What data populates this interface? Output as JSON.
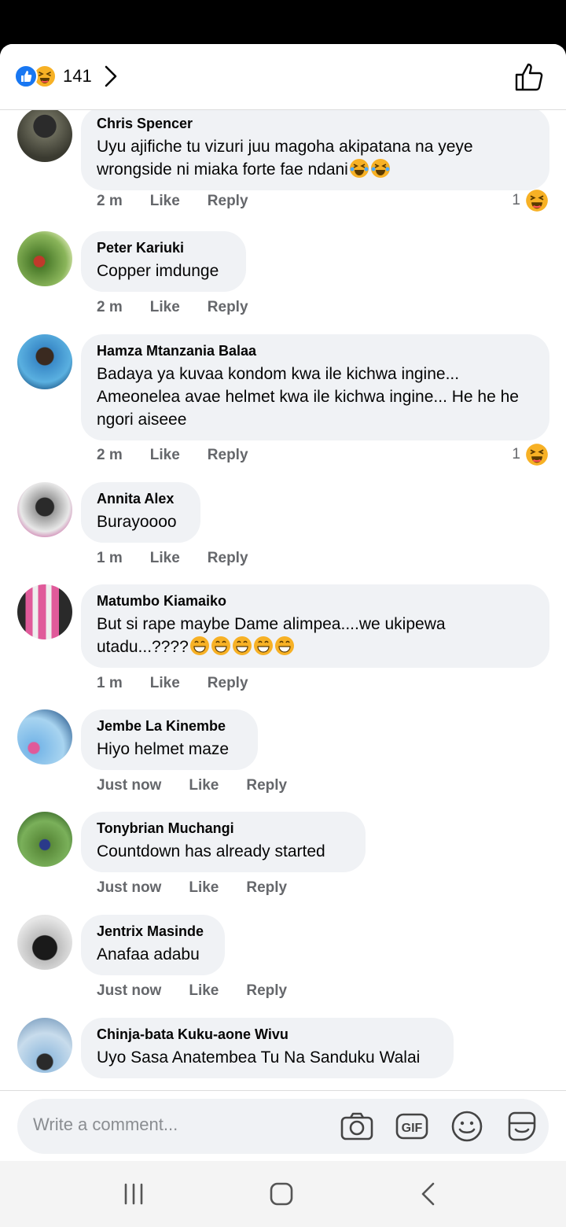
{
  "header": {
    "reaction_count": "141",
    "reaction_icons": [
      "like-icon",
      "haha-icon"
    ]
  },
  "comments": [
    {
      "author": "Chris Spencer",
      "text": "Uyu ajifiche tu vizuri juu magoha akipatana na yeye wrongside ni miaka forte fae ndani",
      "trailing_emoji": [
        "laughing-tears",
        "laughing-tears"
      ],
      "time": "2 m",
      "like_label": "Like",
      "reply_label": "Reply",
      "reaction_count": "1",
      "reaction_icon": "haha-icon"
    },
    {
      "author": "Peter Kariuki",
      "text": "Copper imdunge",
      "time": "2 m",
      "like_label": "Like",
      "reply_label": "Reply"
    },
    {
      "author": "Hamza Mtanzania Balaa",
      "text": "Badaya ya kuvaa kondom kwa ile kichwa ingine... Ameonelea avae helmet kwa ile kichwa ingine... He he he ngori aiseee",
      "time": "2 m",
      "like_label": "Like",
      "reply_label": "Reply",
      "reaction_count": "1",
      "reaction_icon": "haha-icon"
    },
    {
      "author": "Annita Alex",
      "text": "Burayoooo",
      "time": "1 m",
      "like_label": "Like",
      "reply_label": "Reply"
    },
    {
      "author": "Matumbo Kiamaiko",
      "text": "But si rape maybe Dame alimpea....we ukipewa utadu...????",
      "trailing_emoji": [
        "grin",
        "grin",
        "grin",
        "grin",
        "grin"
      ],
      "time": "1 m",
      "like_label": "Like",
      "reply_label": "Reply"
    },
    {
      "author": "Jembe La Kinembe",
      "text": "Hiyo helmet maze",
      "time": "Just now",
      "like_label": "Like",
      "reply_label": "Reply"
    },
    {
      "author": "Tonybrian Muchangi",
      "text": "Countdown has already started",
      "time": "Just now",
      "like_label": "Like",
      "reply_label": "Reply"
    },
    {
      "author": "Jentrix Masinde",
      "text": "Anafaa adabu",
      "time": "Just now",
      "like_label": "Like",
      "reply_label": "Reply"
    },
    {
      "author": "Chinja-bata Kuku-aone Wivu",
      "text": "Uyo Sasa Anatembea Tu Na Sanduku Walai",
      "time": "",
      "like_label": "",
      "reply_label": ""
    }
  ],
  "composer": {
    "placeholder": "Write a comment...",
    "gif_label": "GIF",
    "icons": [
      "camera-icon",
      "gif-icon",
      "emoji-icon",
      "sticker-icon"
    ]
  },
  "navigation": {
    "icons": [
      "recent-apps-icon",
      "home-icon",
      "back-icon"
    ]
  },
  "colors": {
    "accent": "#1877f2",
    "haha": "#f7b125",
    "bubble": "#f0f2f5",
    "meta": "#65676b"
  }
}
